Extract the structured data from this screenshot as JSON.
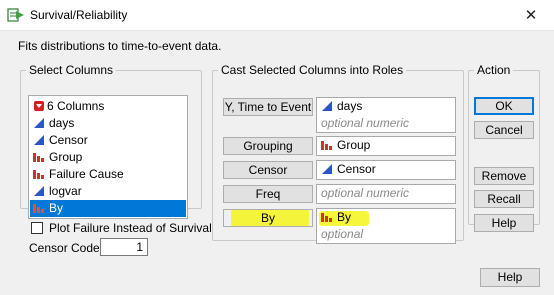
{
  "window": {
    "title": "Survival/Reliability",
    "close_glyph": "✕"
  },
  "description": "Fits distributions to time-to-event data.",
  "select_columns": {
    "legend": "Select Columns",
    "header": "6 Columns",
    "columns": [
      {
        "name": "days",
        "type": "continuous"
      },
      {
        "name": "Censor",
        "type": "continuous"
      },
      {
        "name": "Group",
        "type": "nominal"
      },
      {
        "name": "Failure Cause",
        "type": "nominal"
      },
      {
        "name": "logvar",
        "type": "continuous"
      },
      {
        "name": "By",
        "type": "nominal",
        "selected": true
      }
    ]
  },
  "options": {
    "plot_failure_label": "Plot Failure Instead of Survival",
    "plot_failure_checked": false,
    "censor_code_label": "Censor Code",
    "censor_code_value": "1"
  },
  "roles": {
    "legend": "Cast Selected Columns into Roles",
    "items": [
      {
        "button": "Y, Time to Event",
        "value": "days",
        "value_type": "continuous",
        "hint": "optional numeric"
      },
      {
        "button": "Grouping",
        "value": "Group",
        "value_type": "nominal"
      },
      {
        "button": "Censor",
        "value": "Censor",
        "value_type": "continuous"
      },
      {
        "button": "Freq",
        "hint": "optional numeric"
      },
      {
        "button": "By",
        "value": "By",
        "value_type": "nominal",
        "hint": "optional",
        "highlighted": true
      }
    ]
  },
  "action": {
    "legend": "Action",
    "ok": "OK",
    "cancel": "Cancel",
    "remove": "Remove",
    "recall": "Recall",
    "help": "Help"
  },
  "bottom_help": "Help",
  "colors": {
    "selection": "#0078d7",
    "highlight": "#f4f41a",
    "continuous_icon": "#2a56c6",
    "nominal_icon": "#c0392b"
  }
}
